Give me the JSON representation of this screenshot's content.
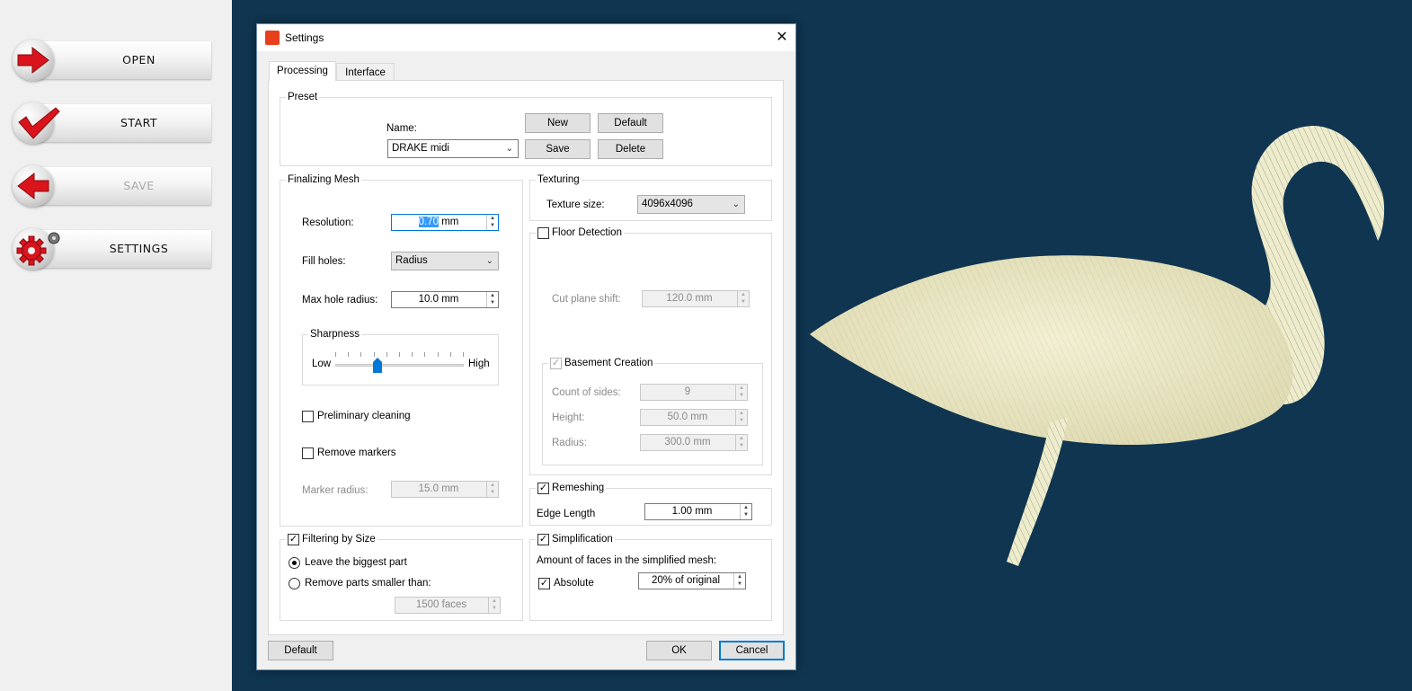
{
  "sidebar": {
    "items": [
      {
        "label": "OPEN",
        "icon": "arrow-right-icon",
        "enabled": true
      },
      {
        "label": "START",
        "icon": "checkmark-icon",
        "enabled": true
      },
      {
        "label": "SAVE",
        "icon": "arrow-left-icon",
        "enabled": false
      },
      {
        "label": "SETTINGS",
        "icon": "gear-icon",
        "enabled": true
      }
    ]
  },
  "colors": {
    "viewport_bg": "#0f3550",
    "model": "#efeccb",
    "accent": "#d9141c"
  },
  "dialog": {
    "title": "Settings",
    "close": "✕",
    "tabs": [
      {
        "label": "Processing",
        "selected": true
      },
      {
        "label": "Interface",
        "selected": false
      }
    ],
    "preset": {
      "title": "Preset",
      "name_label": "Name:",
      "name_value": "DRAKE midi",
      "new": "New",
      "default": "Default",
      "save": "Save",
      "delete": "Delete"
    },
    "finalizing": {
      "title": "Finalizing Mesh",
      "resolution_label": "Resolution:",
      "resolution_sel": "0.70",
      "resolution_unit": " mm",
      "fill_holes_label": "Fill holes:",
      "fill_holes_value": "Radius",
      "max_hole_label": "Max hole radius:",
      "max_hole_value": "10.0 mm",
      "sharpness_title": "Sharpness",
      "sharpness_low": "Low",
      "sharpness_high": "High",
      "sharpness_level": 0.33,
      "preliminary_cleaning": "Preliminary cleaning",
      "remove_markers": "Remove markers",
      "marker_radius_label": "Marker radius:",
      "marker_radius_value": "15.0 mm"
    },
    "filtering": {
      "title": "Filtering by Size",
      "checked": true,
      "leave_biggest": "Leave the biggest part",
      "remove_smaller": "Remove parts smaller than:",
      "faces_value": "1500 faces"
    },
    "texturing": {
      "title": "Texturing",
      "size_label": "Texture size:",
      "size_value": "4096x4096"
    },
    "floor": {
      "title": "Floor Detection",
      "checked": false,
      "cut_plane_label": "Cut plane shift:",
      "cut_plane_value": "120.0 mm",
      "basement_title": "Basement Creation",
      "count_label": "Count of sides:",
      "count_value": "9",
      "height_label": "Height:",
      "height_value": "50.0 mm",
      "radius_label": "Radius:",
      "radius_value": "300.0 mm"
    },
    "remeshing": {
      "title": "Remeshing",
      "checked": true,
      "edge_label": "Edge Length",
      "edge_value": "1.00 mm"
    },
    "simplification": {
      "title": "Simplification",
      "checked": true,
      "amount_label": "Amount of faces in the simplified mesh:",
      "absolute_label": "Absolute",
      "value": "20% of original"
    },
    "footer": {
      "default": "Default",
      "ok": "OK",
      "cancel": "Cancel"
    }
  }
}
